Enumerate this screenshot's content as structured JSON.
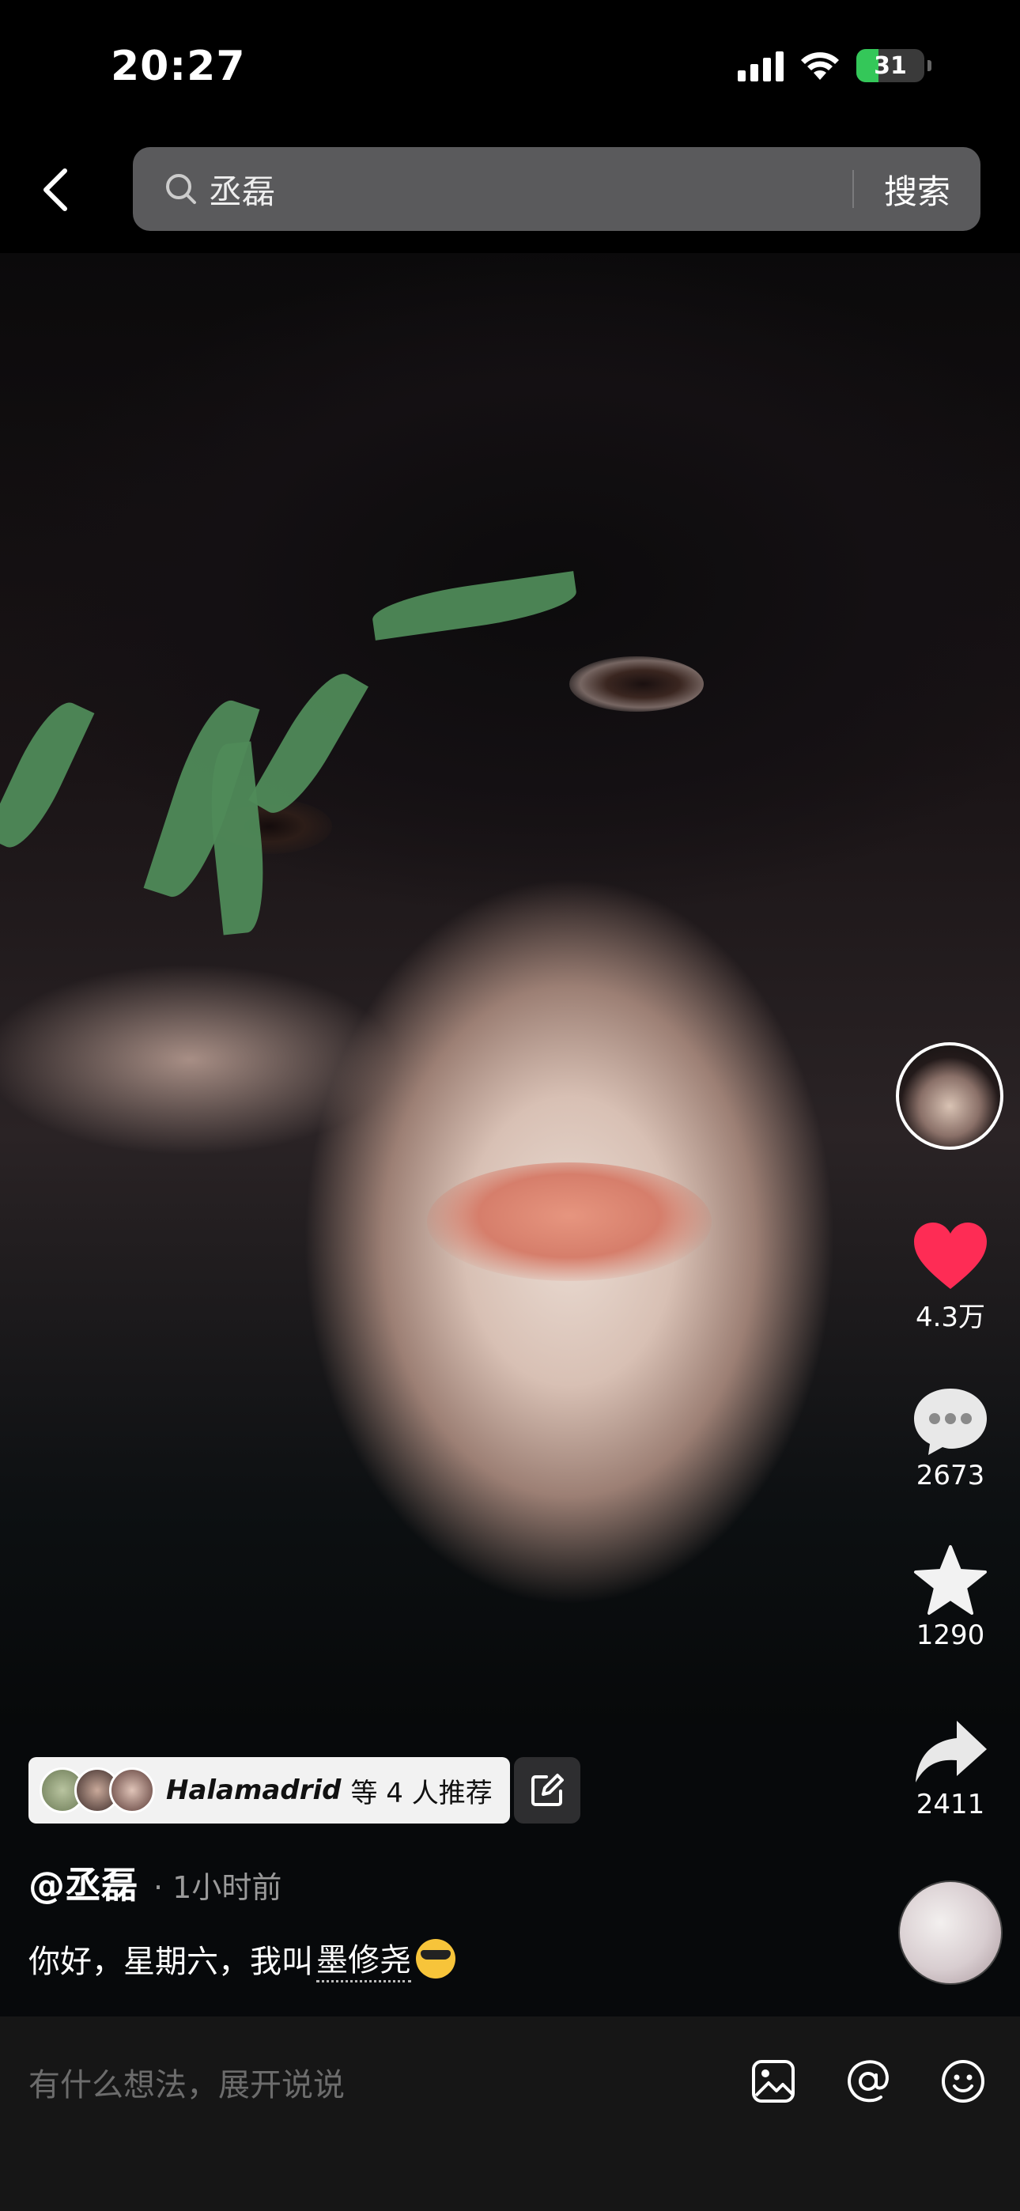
{
  "status_bar": {
    "time": "20:27",
    "battery": "31"
  },
  "search": {
    "query": "丞磊",
    "button_label": "搜索"
  },
  "actions": {
    "likes": "4.3万",
    "comments": "2673",
    "favorites": "1290",
    "shares": "2411"
  },
  "post": {
    "recommend_user": "Halamadrid",
    "recommend_suffix": "等 4 人推荐",
    "author": "@丞磊",
    "time_ago": "· 1小时前",
    "caption_text": "你好，星期六，我叫",
    "caption_tag": "墨修尧"
  },
  "comment_box": {
    "placeholder": "有什么想法，展开说说"
  },
  "colors": {
    "like": "#fe2c55",
    "accent_battery": "#34c759"
  }
}
